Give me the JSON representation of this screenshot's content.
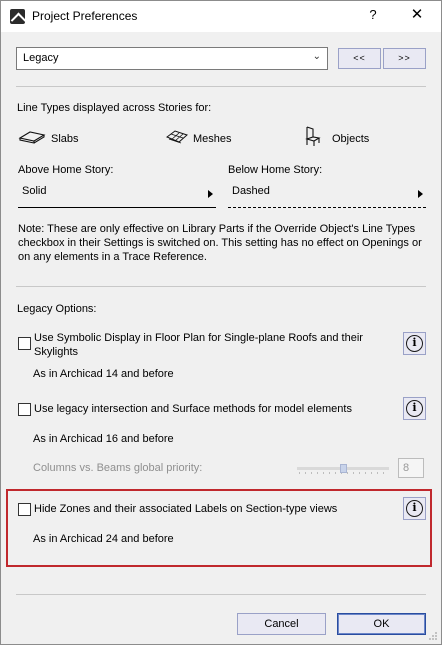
{
  "window": {
    "title": "Project Preferences",
    "help_label": "?",
    "close_label": "✕"
  },
  "header": {
    "page_select_value": "Legacy",
    "prev_label": "<<",
    "next_label": ">>"
  },
  "line_types": {
    "heading": "Line Types displayed across Stories for:",
    "items": [
      {
        "label": "Slabs",
        "icon": "slab-icon"
      },
      {
        "label": "Meshes",
        "icon": "mesh-icon"
      },
      {
        "label": "Objects",
        "icon": "chair-icon"
      }
    ],
    "above_label": "Above Home Story:",
    "above_value": "Solid",
    "below_label": "Below Home Story:",
    "below_value": "Dashed",
    "note": "Note: These are only effective on Library Parts if the Override Object's Line Types checkbox in their Settings is switched on. This setting has no effect on Openings or on any elements in a Trace Reference."
  },
  "legacy": {
    "heading": "Legacy Options:",
    "options": [
      {
        "label": "Use Symbolic Display in Floor Plan for Single-plane Roofs and their Skylights",
        "checked": false,
        "sub": "As in Archicad 14 and before"
      },
      {
        "label": "Use legacy intersection and Surface methods for model elements",
        "checked": false,
        "sub": "As in Archicad 16 and before"
      },
      {
        "label": "Hide Zones and their associated Labels on Section-type views",
        "checked": false,
        "sub": "As in Archicad 24 and before"
      }
    ],
    "priority_label": "Columns vs. Beams global priority:",
    "priority_value": "8",
    "info_glyph": "i"
  },
  "footer": {
    "cancel_label": "Cancel",
    "ok_label": "OK"
  },
  "colors": {
    "highlight": "#c0282d",
    "button_face": "#e9e9f3",
    "button_border": "#9aa1c7"
  }
}
